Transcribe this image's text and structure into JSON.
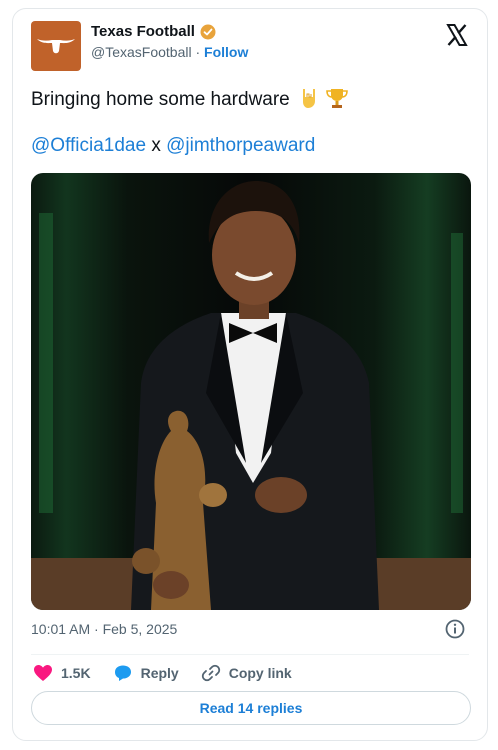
{
  "author": {
    "name": "Texas Football",
    "handle": "@TexasFootball",
    "separator": "·",
    "follow_label": "Follow"
  },
  "tweet": {
    "text": "Bringing home some hardware",
    "emojis": [
      "rock-on-hand-icon",
      "trophy-icon"
    ],
    "mention_1": "@Officia1dae",
    "connector": "x",
    "mention_2": "@jimthorpeaward"
  },
  "meta": {
    "timestamp": "10:01 AM · Feb 5, 2025"
  },
  "actions": {
    "like_count": "1.5K",
    "reply_label": "Reply",
    "copy_label": "Copy link"
  },
  "footer": {
    "read_replies_label": "Read 14 replies"
  },
  "colors": {
    "brand_orange": "#c0622a",
    "link_blue": "#1d7fd6",
    "like_pink": "#f91880",
    "muted": "#536471"
  }
}
